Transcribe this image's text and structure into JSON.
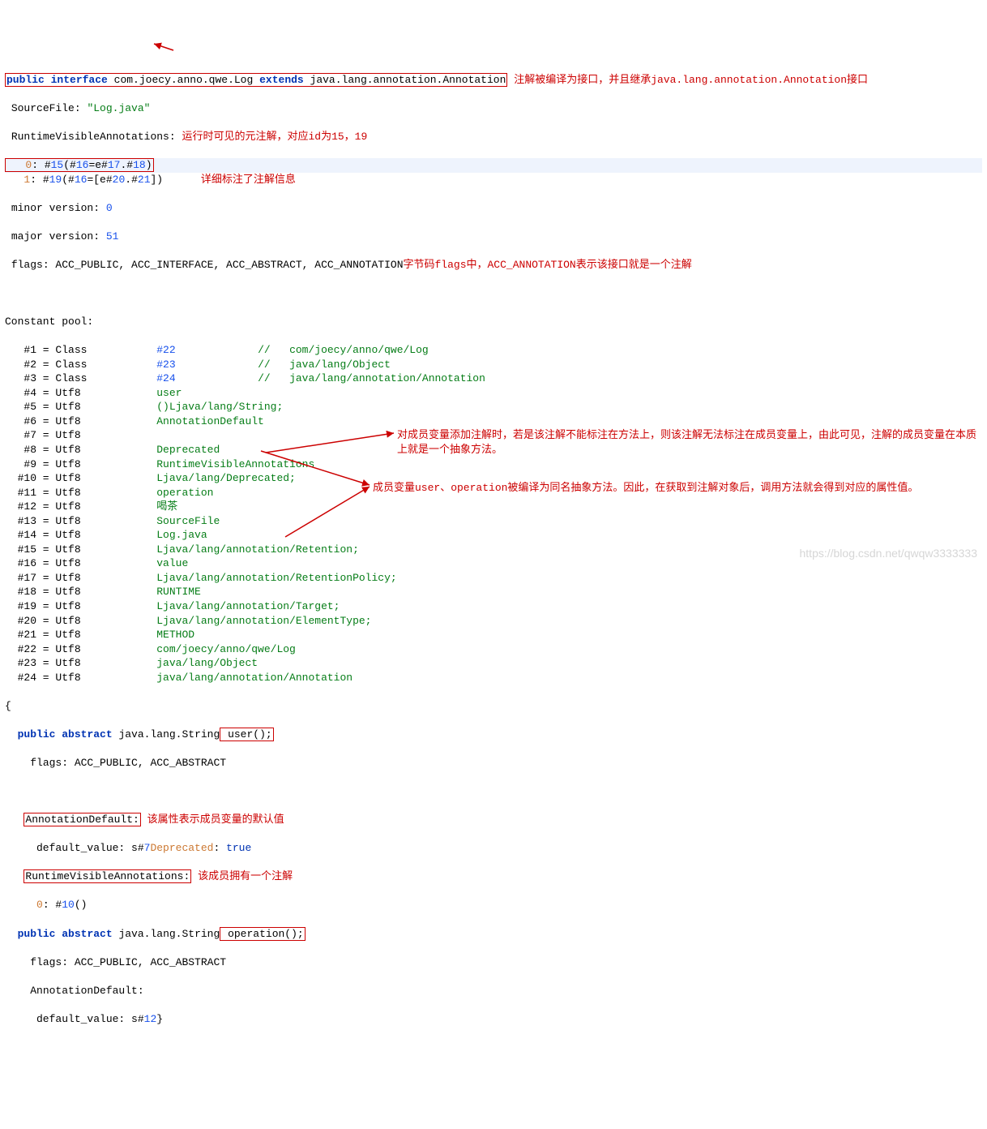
{
  "header": {
    "decl_html": "<span class=\"kw-blue\">public</span> <span class=\"kw-blue\">interface</span> <span class=\"pkg\">com.joecy.anno.qwe.Log</span> <span class=\"kw-blue\">extends</span> <span class=\"pkg\">java.lang.annotation.Annotation</span>",
    "annot1": "注解被编译为接口，并且继承java.lang.annotation.Annotation接口"
  },
  "src": {
    "label": "SourceFile:",
    "val": "\"Log.java\""
  },
  "rva": {
    "label": "RuntimeVisibleAnnotations:",
    "annot": "运行时可见的元注解，对应id为15，19",
    "l0": "   <span class=\"orange\">0</span>: #<span class=\"num\">15</span>(#<span class=\"num\">16</span>=e#<span class=\"num\">17</span>.#<span class=\"num\">18</span>)",
    "l1": "   <span class=\"orange\">1</span>: #<span class=\"num\">19</span>(#<span class=\"num\">16</span>=[e#<span class=\"num\">20</span>.#<span class=\"num\">21</span>])",
    "annot_detail": "详细标注了注解信息"
  },
  "minor": {
    "label": "minor version:",
    "val": "0"
  },
  "major": {
    "label": "major version:",
    "val": "51"
  },
  "flags": {
    "text": "flags: ACC_PUBLIC, ACC_INTERFACE, ACC_ABSTRACT, ACC_ANNOTATION",
    "annot": "字节码flags中，ACC_ANNOTATION表示该接口就是一个注解"
  },
  "cp": {
    "title": "Constant pool:",
    "rows": [
      {
        "n": "#1",
        "eq": "= Class",
        "ref": "#22",
        "cmt": "//   com/joecy/anno/qwe/Log"
      },
      {
        "n": "#2",
        "eq": "= Class",
        "ref": "#23",
        "cmt": "//   java/lang/Object"
      },
      {
        "n": "#3",
        "eq": "= Class",
        "ref": "#24",
        "cmt": "//   java/lang/annotation/Annotation"
      },
      {
        "n": "#4",
        "eq": "= Utf8",
        "ref": "",
        "cmt": "user"
      },
      {
        "n": "#5",
        "eq": "= Utf8",
        "ref": "",
        "cmt": "()Ljava/lang/String;"
      },
      {
        "n": "#6",
        "eq": "= Utf8",
        "ref": "",
        "cmt": "AnnotationDefault"
      },
      {
        "n": "#7",
        "eq": "= Utf8",
        "ref": "",
        "cmt": ""
      },
      {
        "n": "#8",
        "eq": "= Utf8",
        "ref": "",
        "cmt": "Deprecated"
      },
      {
        "n": "#9",
        "eq": "= Utf8",
        "ref": "",
        "cmt": "RuntimeVisibleAnnotations"
      },
      {
        "n": "#10",
        "eq": "= Utf8",
        "ref": "",
        "cmt": "Ljava/lang/Deprecated;"
      },
      {
        "n": "#11",
        "eq": "= Utf8",
        "ref": "",
        "cmt": "operation"
      },
      {
        "n": "#12",
        "eq": "= Utf8",
        "ref": "",
        "cmt": "喝茶"
      },
      {
        "n": "#13",
        "eq": "= Utf8",
        "ref": "",
        "cmt": "SourceFile"
      },
      {
        "n": "#14",
        "eq": "= Utf8",
        "ref": "",
        "cmt": "Log.java"
      },
      {
        "n": "#15",
        "eq": "= Utf8",
        "ref": "",
        "cmt": "Ljava/lang/annotation/Retention;"
      },
      {
        "n": "#16",
        "eq": "= Utf8",
        "ref": "",
        "cmt": "value"
      },
      {
        "n": "#17",
        "eq": "= Utf8",
        "ref": "",
        "cmt": "Ljava/lang/annotation/RetentionPolicy;"
      },
      {
        "n": "#18",
        "eq": "= Utf8",
        "ref": "",
        "cmt": "RUNTIME"
      },
      {
        "n": "#19",
        "eq": "= Utf8",
        "ref": "",
        "cmt": "Ljava/lang/annotation/Target;"
      },
      {
        "n": "#20",
        "eq": "= Utf8",
        "ref": "",
        "cmt": "Ljava/lang/annotation/ElementType;"
      },
      {
        "n": "#21",
        "eq": "= Utf8",
        "ref": "",
        "cmt": "METHOD"
      },
      {
        "n": "#22",
        "eq": "= Utf8",
        "ref": "",
        "cmt": "com/joecy/anno/qwe/Log"
      },
      {
        "n": "#23",
        "eq": "= Utf8",
        "ref": "",
        "cmt": "java/lang/Object"
      },
      {
        "n": "#24",
        "eq": "= Utf8",
        "ref": "",
        "cmt": "java/lang/annotation/Annotation"
      }
    ]
  },
  "methods": {
    "open": "{",
    "m1": {
      "decl_pre": "<span class=\"kw-blue\">public</span> <span class=\"kw-blue\">abstract</span> java.lang.String",
      "boxed": " user();",
      "flags": "flags: ACC_PUBLIC, ACC_ABSTRACT",
      "ad_label": "AnnotationDefault:",
      "ad_annot": "该属性表示成员变量的默认值",
      "dv": "     default_value: s#<span class=\"num\">7</span><span class=\"orange\">Deprecated</span>: <span class=\"kw-blue-nb\">true</span>",
      "rva_label": "RuntimeVisibleAnnotations:",
      "rva_annot": "该成员拥有一个注解",
      "rva_line": "     <span class=\"orange\">0</span>: #<span class=\"num\">10</span>()"
    },
    "m2": {
      "decl_pre": "<span class=\"kw-blue\">public</span> <span class=\"kw-blue\">abstract</span> java.lang.String",
      "boxed": " operation();",
      "flags": "flags: ACC_PUBLIC, ACC_ABSTRACT",
      "ad_label": "AnnotationDefault:",
      "dv": "     default_value: s#<span class=\"num\">12</span>}"
    }
  },
  "side_notes": {
    "note1": "对成员变量添加注解时，若是该注解不能标注在方法上，则该注解无法标注在成员变量上，由此可见，注解的成员变量在本质上就是一个抽象方法。",
    "note2": "成员变量user、operation被编译为同名抽象方法。因此，在获取到注解对象后，调用方法就会得到对应的属性值。"
  },
  "watermark": "https://blog.csdn.net/qwqw3333333"
}
